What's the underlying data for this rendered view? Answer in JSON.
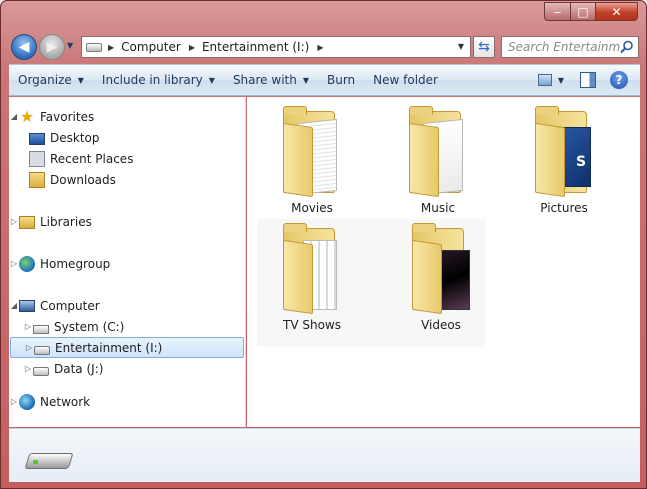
{
  "window": {
    "controls": {
      "minimize": "‒",
      "maximize": "□",
      "close": "✕"
    }
  },
  "navigation": {
    "back_icon": "back-arrow-icon",
    "forward_icon": "forward-arrow-icon"
  },
  "address_bar": {
    "crumbs": [
      "Computer",
      "Entertainment (I:)"
    ]
  },
  "search": {
    "placeholder": "Search Entertainm..."
  },
  "command_bar": {
    "organize": "Organize",
    "include_in_library": "Include in library",
    "share_with": "Share with",
    "burn": "Burn",
    "new_folder": "New folder",
    "help": "?"
  },
  "nav_pane": {
    "favorites": "Favorites",
    "desktop": "Desktop",
    "recent_places": "Recent Places",
    "downloads": "Downloads",
    "libraries": "Libraries",
    "homegroup": "Homegroup",
    "computer": "Computer",
    "system": "System (C:)",
    "entertainment": "Entertainment (I:)",
    "data": "Data (J:)",
    "network": "Network"
  },
  "folders": [
    {
      "name": "Movies",
      "icon": "folder-documents-icon"
    },
    {
      "name": "Music",
      "icon": "folder-blank-icon"
    },
    {
      "name": "Pictures",
      "icon": "folder-pictures-icon"
    },
    {
      "name": "TV Shows",
      "icon": "folder-video-icon"
    },
    {
      "name": "Videos",
      "icon": "folder-dark-thumbnail-icon"
    }
  ],
  "pictures_thumb_text": "S"
}
